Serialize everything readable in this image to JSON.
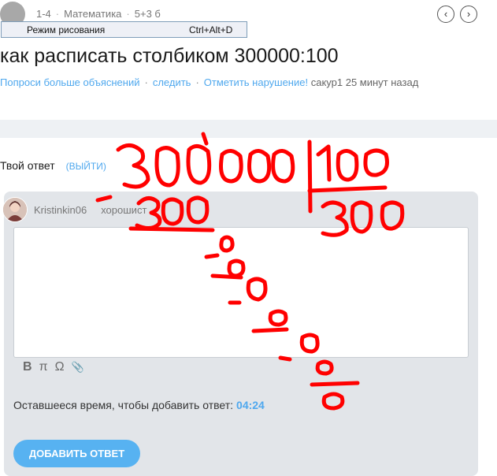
{
  "header": {
    "grade": "1-4",
    "subject": "Математика",
    "points": "5+3 б",
    "nav_prev": "‹",
    "nav_next": "›"
  },
  "tooltip": {
    "label": "Режим рисования",
    "shortcut": "Ctrl+Alt+D"
  },
  "question": {
    "title": "как расписать столбиком 300000:100",
    "ask_more": "Попроси больше объяснений",
    "follow": "следить",
    "report": "Отметить нарушение!",
    "author": "сакур1",
    "time_ago": "25 минут назад"
  },
  "answer": {
    "label": "Твой ответ",
    "exit_label": "(ВЫЙТИ)",
    "username": "Kristinkin06",
    "rank": "хорошист",
    "toolbar": {
      "bold": "B",
      "pi": "π",
      "omega": "Ω",
      "attach": "📎"
    },
    "timer_text": "Оставшееся время, чтобы добавить ответ:",
    "timer_value": "04:24",
    "submit_label": "ДОБАВИТЬ ОТВЕТ"
  },
  "colors": {
    "accent": "#4fa8ee",
    "button": "#57b2f1",
    "panel": "#e2e5e9",
    "ink": "#ff0000"
  }
}
